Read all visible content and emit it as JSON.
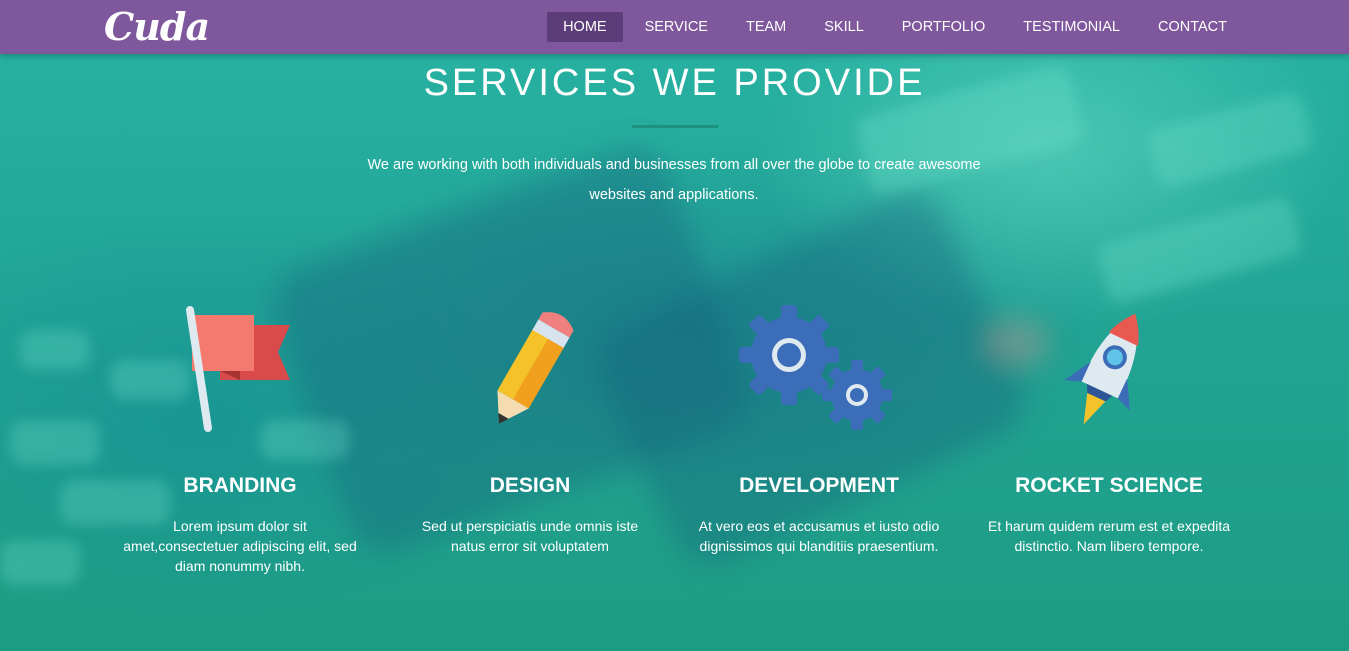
{
  "brand": {
    "logo": "Cuda"
  },
  "nav": {
    "items": [
      {
        "label": "HOME",
        "active": true
      },
      {
        "label": "SERVICE",
        "active": false
      },
      {
        "label": "TEAM",
        "active": false
      },
      {
        "label": "SKILL",
        "active": false
      },
      {
        "label": "PORTFOLIO",
        "active": false
      },
      {
        "label": "TESTIMONIAL",
        "active": false
      },
      {
        "label": "CONTACT",
        "active": false
      }
    ]
  },
  "section": {
    "title": "SERVICES WE PROVIDE",
    "subtitle": "We are working with both individuals and businesses from all over the globe to create awesome websites and applications."
  },
  "services": [
    {
      "icon": "flag-icon",
      "title": "BRANDING",
      "text": "Lorem ipsum dolor sit amet,consectetuer adipiscing elit, sed diam nonummy nibh."
    },
    {
      "icon": "pencil-icon",
      "title": "DESIGN",
      "text": "Sed ut perspiciatis unde omnis iste natus error sit voluptatem"
    },
    {
      "icon": "gears-icon",
      "title": "DEVELOPMENT",
      "text": "At vero eos et accusamus et iusto odio dignissimos qui blanditiis praesentium."
    },
    {
      "icon": "rocket-icon",
      "title": "ROCKET SCIENCE",
      "text": "Et harum quidem rerum est et expedita distinctio. Nam libero tempore."
    }
  ],
  "colors": {
    "navbar": "#7e579c",
    "nav_active": "#5c3d7a",
    "background": "#1fa58f",
    "text": "#ffffff"
  }
}
